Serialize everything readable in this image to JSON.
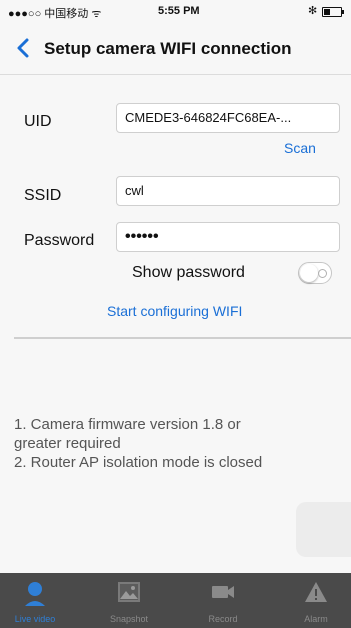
{
  "status_bar": {
    "carrier": "●●●○○ 中国移动 ᯤ",
    "time": "5:55 PM",
    "bluetooth": "✻"
  },
  "nav": {
    "title": "Setup camera WIFI connection",
    "back_icon": "chevron-left-icon"
  },
  "form": {
    "uid_label": "UID",
    "uid_value": "CMEDE3-646824FC68EA-...",
    "scan_label": "Scan",
    "ssid_label": "SSID",
    "ssid_value": "cwl",
    "password_label": "Password",
    "password_value": "••••••",
    "show_password_label": "Show password",
    "show_password_on": false,
    "start_label": "Start configuring WIFI"
  },
  "notes": {
    "line1": "1. Camera firmware version 1.8 or",
    "line2": "greater required",
    "line3": "2. Router AP isolation mode is closed"
  },
  "tabs": [
    {
      "label": "Live video",
      "icon": "person-icon",
      "active": true
    },
    {
      "label": "Snapshot",
      "icon": "image-icon",
      "active": false
    },
    {
      "label": "Record",
      "icon": "video-camera-icon",
      "active": false
    },
    {
      "label": "Alarm",
      "icon": "warning-icon",
      "active": false
    }
  ],
  "colors": {
    "accent": "#1a6fd6",
    "tab_bar": "#4a4a4a",
    "active_tab": "#2f7fd6"
  }
}
